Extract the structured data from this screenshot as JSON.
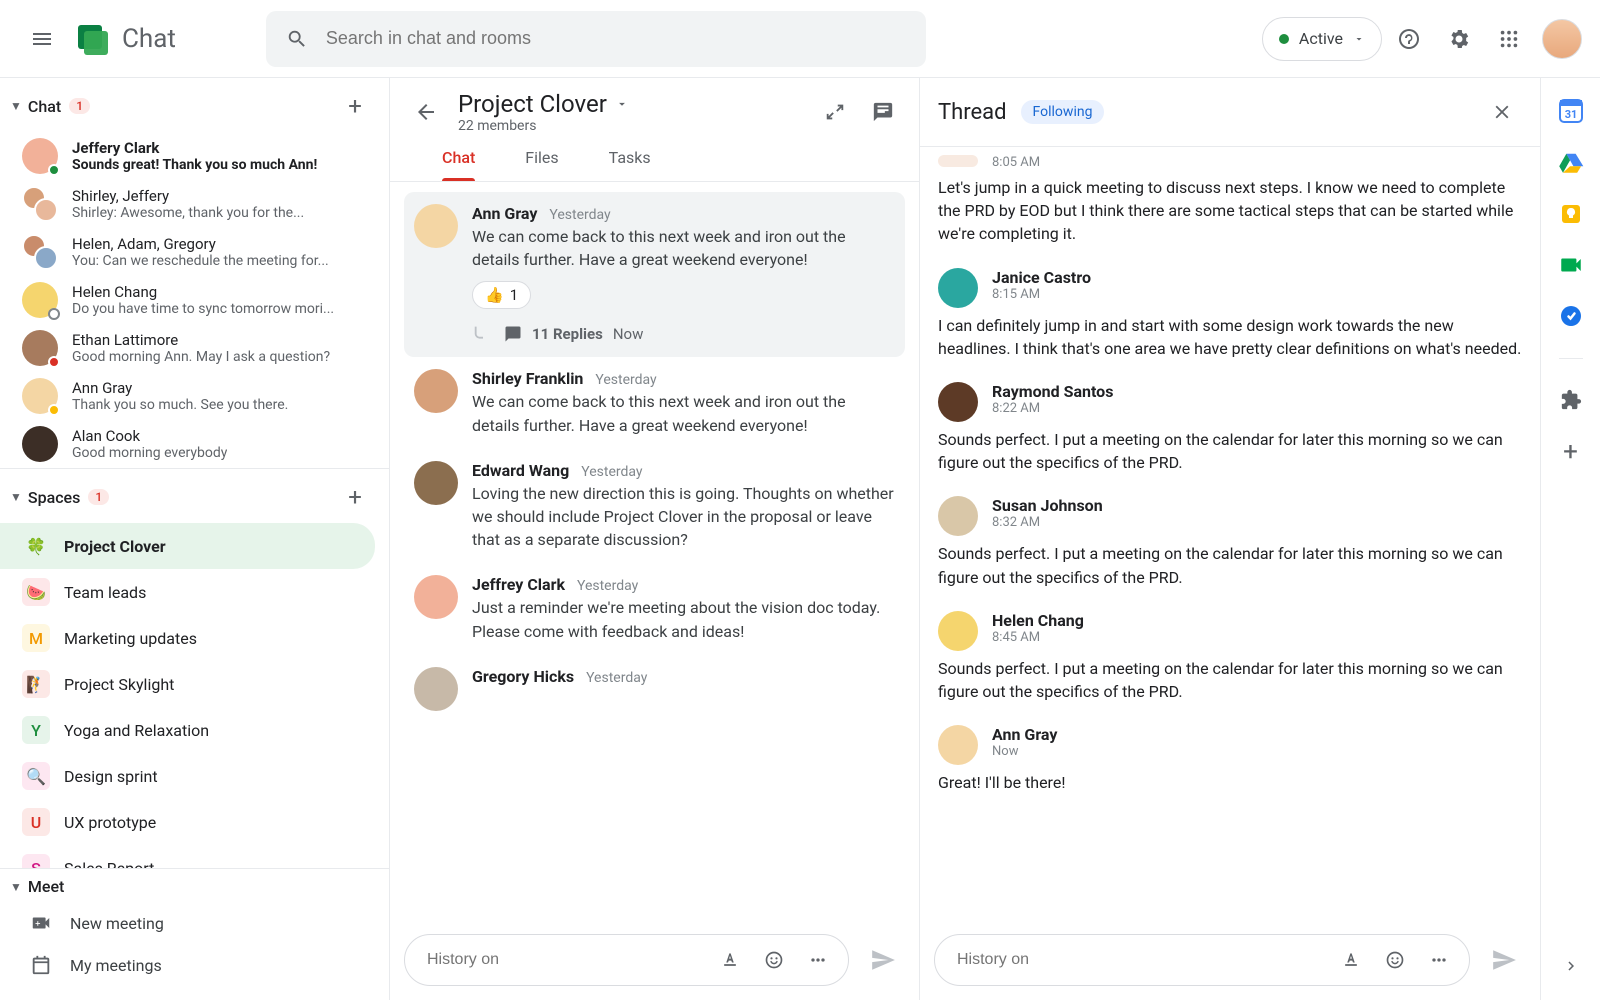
{
  "header": {
    "app_title": "Chat",
    "search_placeholder": "Search in chat and rooms",
    "status_label": "Active"
  },
  "sidebar": {
    "chat_section": {
      "title": "Chat",
      "badge": "1"
    },
    "chats": [
      {
        "name": "Jeffery Clark",
        "preview": "Sounds great! Thank you so much Ann!",
        "bold": true,
        "avatar": "#f2b199",
        "presence": "#1e8e3e"
      },
      {
        "name": "Shirley, Jeffery",
        "preview": "Shirley: Awesome, thank you for the...",
        "double": true,
        "a1": "#d7a07a",
        "a2": "#e8b89b"
      },
      {
        "name": "Helen, Adam, Gregory",
        "preview": "You: Can we reschedule the meeting for...",
        "double": true,
        "a1": "#c98c6b",
        "a2": "#8aa8c8"
      },
      {
        "name": "Helen Chang",
        "preview": "Do you have time to sync tomorrow mori...",
        "avatar": "#f5d56e",
        "presence": "#fff",
        "presenceBorder": "#80868b"
      },
      {
        "name": "Ethan Lattimore",
        "preview": "Good morning Ann. May I ask a question?",
        "avatar": "#a77b5e",
        "presence": "#d93025"
      },
      {
        "name": "Ann Gray",
        "preview": "Thank you so much. See you there.",
        "avatar": "#f4d6a4",
        "presence": "#fbbc04"
      },
      {
        "name": "Alan Cook",
        "preview": "Good morning everybody",
        "avatar": "#3c2e26"
      }
    ],
    "spaces_section": {
      "title": "Spaces",
      "badge": "1"
    },
    "spaces": [
      {
        "label": "Project Clover",
        "icon": "🍀",
        "bg": "#e6f4ea",
        "active": true
      },
      {
        "label": "Team leads",
        "icon": "🍉",
        "bg": "#fde7e9"
      },
      {
        "label": "Marketing updates",
        "icon": "M",
        "bg": "#fef7e0",
        "fg": "#f29900"
      },
      {
        "label": "Project Skylight",
        "icon": "🧗",
        "bg": "#fce8e6"
      },
      {
        "label": "Yoga and Relaxation",
        "icon": "Y",
        "bg": "#e6f4ea",
        "fg": "#1e8e3e"
      },
      {
        "label": "Design sprint",
        "icon": "🔍",
        "bg": "#fde7f1"
      },
      {
        "label": "UX prototype",
        "icon": "U",
        "bg": "#fce8e6",
        "fg": "#d93025"
      },
      {
        "label": "Sales Report",
        "icon": "S",
        "bg": "#fde7f1",
        "fg": "#d01884"
      }
    ],
    "meet_section": {
      "title": "Meet"
    },
    "meet": {
      "new_meeting": "New meeting",
      "my_meetings": "My meetings"
    }
  },
  "room": {
    "title": "Project Clover",
    "subtitle": "22 members",
    "tabs": [
      "Chat",
      "Files",
      "Tasks"
    ],
    "active_tab": 0,
    "messages": [
      {
        "name": "Ann Gray",
        "time": "Yesterday",
        "body": "We can come back to this next week and iron out the details further. Have a great weekend everyone!",
        "avatar": "#f4d6a4",
        "highlighted": true,
        "reaction_emoji": "👍",
        "reaction_count": "1",
        "replies_label": "11 Replies",
        "replies_time": "Now"
      },
      {
        "name": "Shirley Franklin",
        "time": "Yesterday",
        "body": "We can come back to this next week and iron out the details further. Have a great weekend everyone!",
        "avatar": "#d7a07a"
      },
      {
        "name": "Edward Wang",
        "time": "Yesterday",
        "body": "Loving the new direction this is going. Thoughts on whether we should include Project Clover in the proposal or leave that as a separate discussion?",
        "avatar": "#8b6e4f"
      },
      {
        "name": "Jeffrey Clark",
        "time": "Yesterday",
        "body": "Just a reminder we're meeting about the vision doc today. Please come with feedback and ideas!",
        "avatar": "#f2b199"
      },
      {
        "name": "Gregory Hicks",
        "time": "Yesterday",
        "body": "",
        "avatar": "#c7b9a8"
      }
    ],
    "compose_placeholder": "History on"
  },
  "thread": {
    "title": "Thread",
    "following_label": "Following",
    "cutoff": {
      "time": "8:05 AM",
      "body": "Let's jump in a quick meeting to discuss next steps. I know we need to complete the PRD by EOD but I think there are some tactical steps that can be started while we're completing it."
    },
    "messages": [
      {
        "name": "Janice Castro",
        "time": "8:15 AM",
        "body": "I can definitely jump in and start with some design work towards the new headlines. I think that's one area we have pretty clear definitions on what's needed.",
        "avatar": "#2aa7a0"
      },
      {
        "name": "Raymond Santos",
        "time": "8:22 AM",
        "body": "Sounds perfect. I put a meeting on the calendar for later this morning so we can figure out the specifics of the PRD.",
        "avatar": "#5d3a26"
      },
      {
        "name": "Susan Johnson",
        "time": "8:32 AM",
        "body": "Sounds perfect. I put a meeting on the calendar for later this morning so we can figure out the specifics of the PRD.",
        "avatar": "#d9c7a8"
      },
      {
        "name": "Helen Chang",
        "time": "8:45 AM",
        "body": "Sounds perfect. I put a meeting on the calendar for later this morning so we can figure out the specifics of the PRD.",
        "avatar": "#f5d56e"
      },
      {
        "name": "Ann Gray",
        "time": "Now",
        "body": "Great! I'll be there!",
        "avatar": "#f4d6a4"
      }
    ],
    "compose_placeholder": "History on"
  }
}
